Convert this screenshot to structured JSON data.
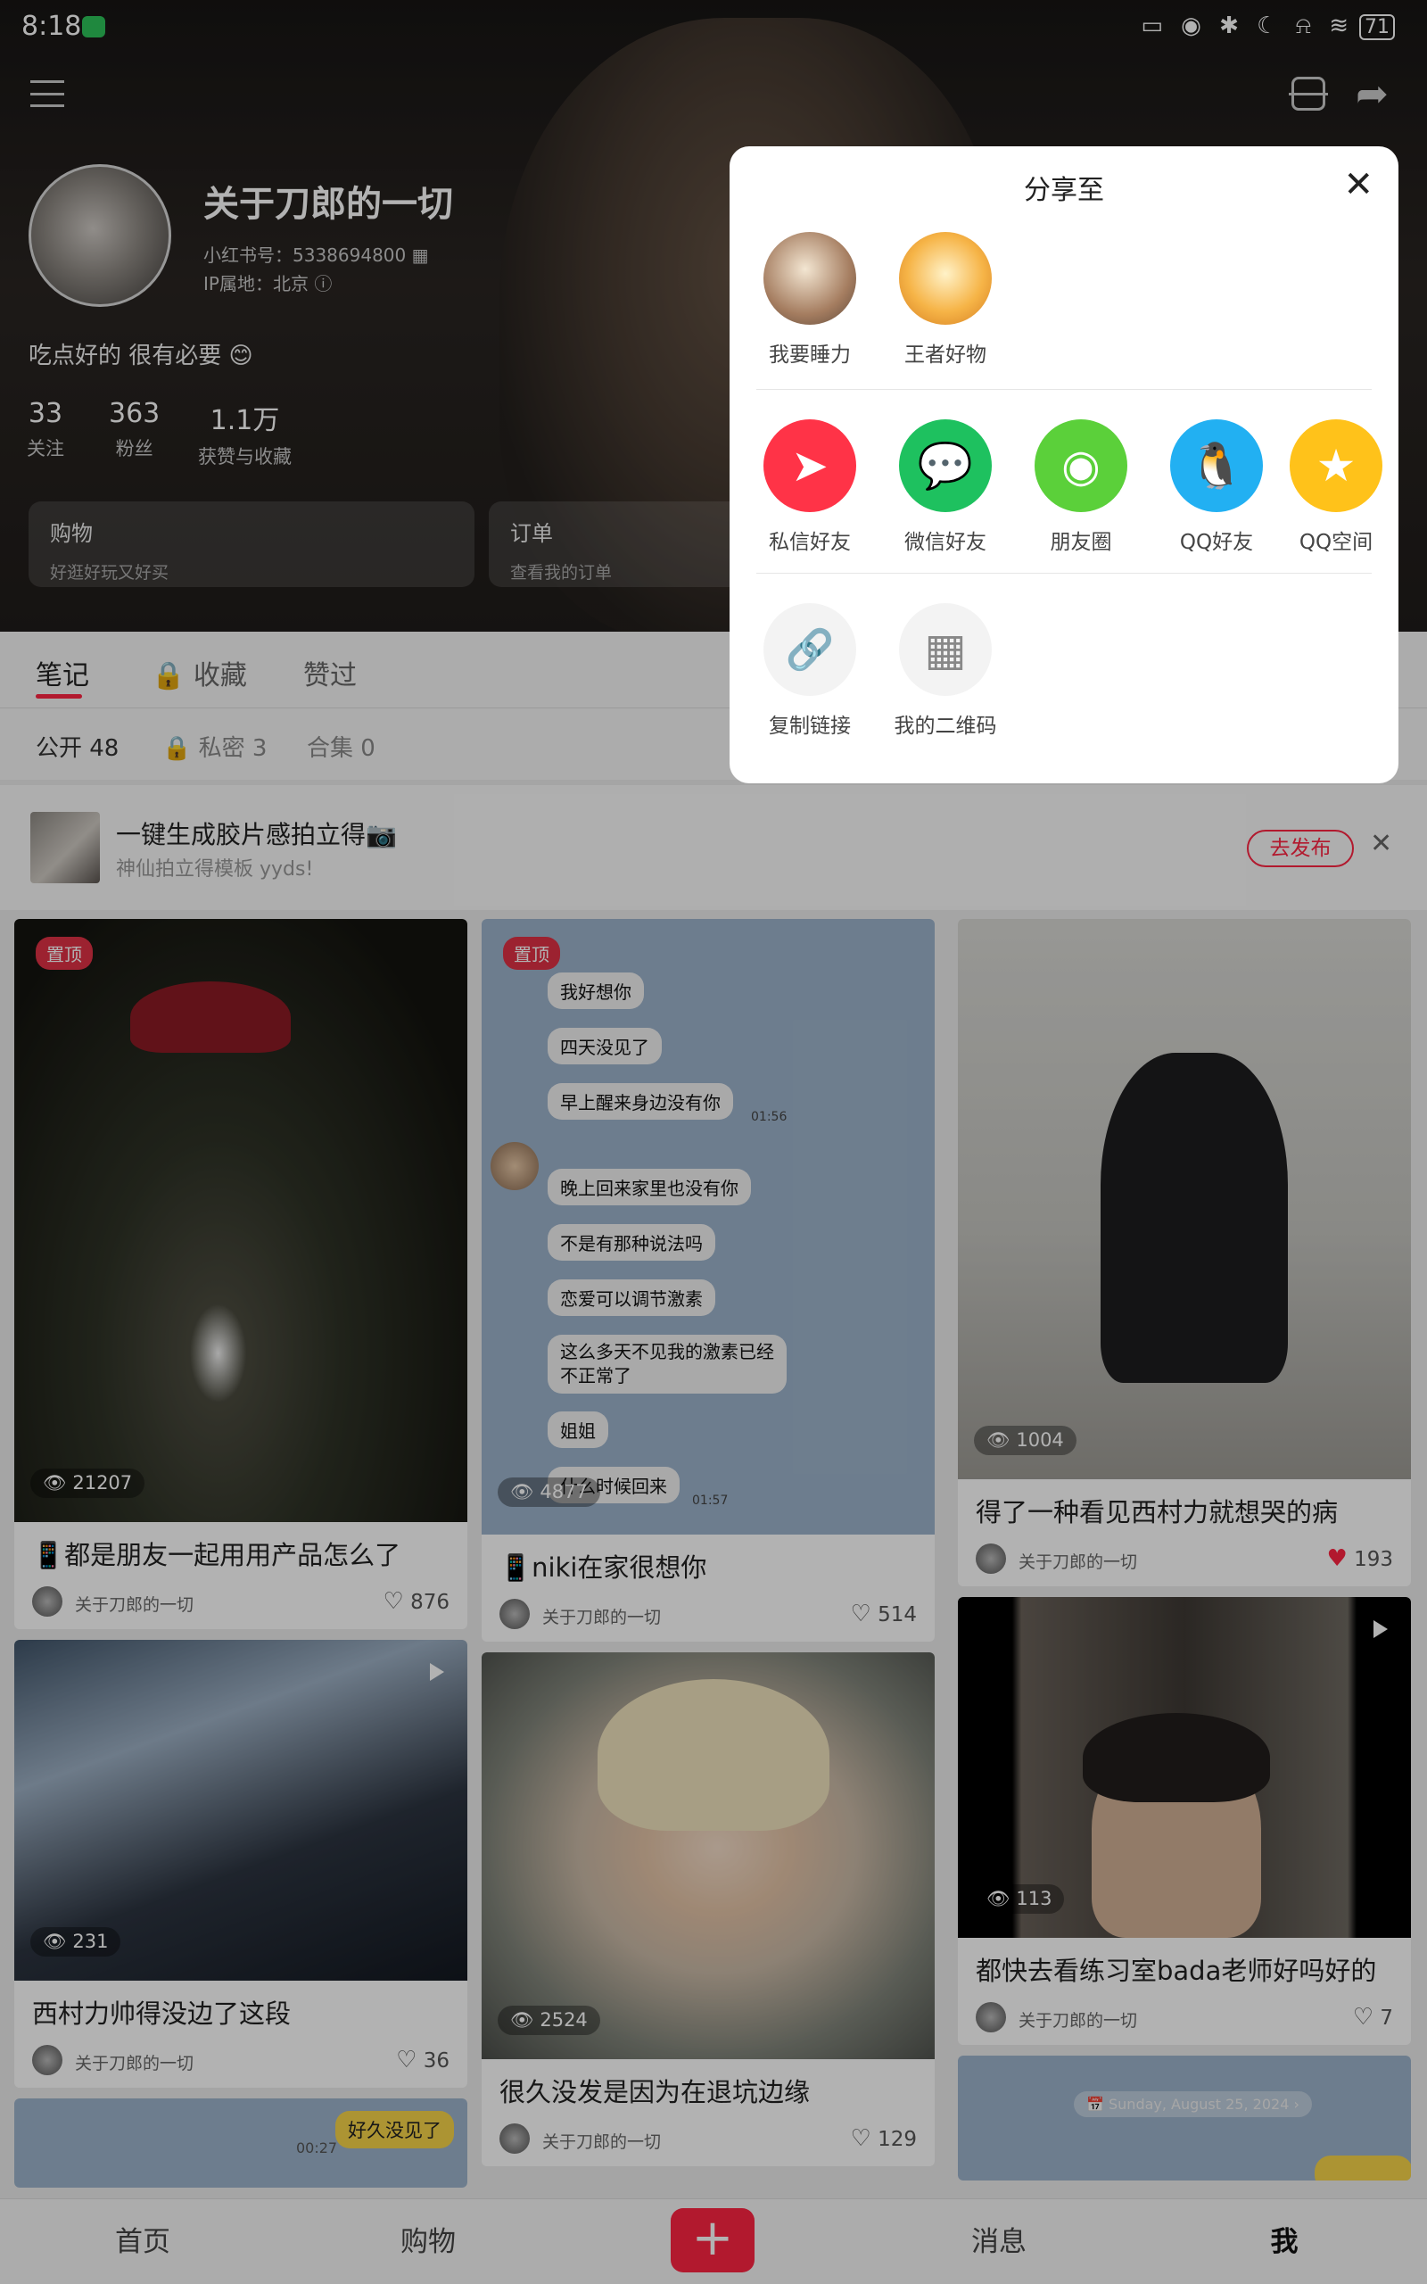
{
  "status_bar": {
    "time": "8:18",
    "battery": "71",
    "icons": "▭ ◉ ✱ ☾ ⍾ ≋"
  },
  "profile": {
    "name": "关于刀郎的一切",
    "red_id": "小红书号：5338694800 ▦",
    "ip": "IP属地：北京 ⓘ",
    "bio": "吃点好的 很有必要 😊",
    "stats": [
      {
        "num": "33",
        "label": "关注"
      },
      {
        "num": "363",
        "label": "粉丝"
      },
      {
        "num": "1.1万",
        "label": "获赞与收藏"
      }
    ],
    "cards": [
      {
        "title": "购物",
        "sub": "好逛好玩又好买"
      },
      {
        "title": "订单",
        "sub": "查看我的订单"
      }
    ]
  },
  "tabs": [
    "笔记",
    "🔒 收藏",
    "赞过"
  ],
  "subtabs": [
    "公开 48",
    "🔒 私密 3",
    "合集 0"
  ],
  "promo": {
    "title": "一键生成胶片感拍立得📷",
    "sub": "神仙拍立得模板 yyds!",
    "button": "去发布",
    "close": "✕"
  },
  "notes": {
    "col1": [
      {
        "pin": "置顶",
        "views": "21207",
        "title": "📱都是朋友一起用用产品怎么了",
        "author": "关于刀郎的一切",
        "likes": "876"
      },
      {
        "views": "231",
        "title": "西村力帅得没边了这段",
        "author": "关于刀郎的一切",
        "likes": "36"
      },
      {
        "time": "00:27",
        "tag": "好久没见了"
      }
    ],
    "col2": [
      {
        "pin": "置顶",
        "views": "4877",
        "title": "📱niki在家很想你",
        "author": "关于刀郎的一切",
        "likes": "514",
        "chat": [
          {
            "text": "我好想你"
          },
          {
            "text": "四天没见了"
          },
          {
            "text": "早上醒来身边没有你"
          },
          {
            "text": "01:56"
          },
          {
            "text": "晚上回来家里也没有你"
          },
          {
            "text": "不是有那种说法吗"
          },
          {
            "text": "恋爱可以调节激素"
          },
          {
            "text": "这么多天不见我的激素已经\n不正常了"
          },
          {
            "text": "姐姐"
          },
          {
            "text": "什么时候回来"
          },
          {
            "text": "01:57"
          }
        ]
      },
      {
        "views": "2524",
        "title": "很久没发是因为在退坑边缘",
        "author": "关于刀郎的一切",
        "likes": "129"
      }
    ],
    "col3": [
      {
        "views": "1004",
        "title": "得了一种看见西村力就想哭的病",
        "author": "关于刀郎的一切",
        "likes": "193"
      },
      {
        "views": "113",
        "title": "都快去看练习室bada老师好吗好的",
        "author": "关于刀郎的一切",
        "likes": "7"
      },
      {
        "date": "📅 Sunday, August 25, 2024 ›"
      }
    ]
  },
  "bottom_nav": [
    "首页",
    "购物",
    "+",
    "消息",
    "我"
  ],
  "share_sheet": {
    "title": "分享至",
    "close": "✕",
    "contacts": [
      {
        "label": "我要睡力"
      },
      {
        "label": "王者好物"
      }
    ],
    "apps": [
      {
        "label": "私信好友",
        "icon": "➤",
        "color": "#ff3347"
      },
      {
        "label": "微信好友",
        "icon": "💬",
        "color": "#1ec15f"
      },
      {
        "label": "朋友圈",
        "icon": "◉",
        "color": "#5bd03a"
      },
      {
        "label": "QQ好友",
        "icon": "🐧",
        "color": "#22b0f2"
      },
      {
        "label": "QQ空间",
        "icon": "★",
        "color": "#ffc21a"
      }
    ],
    "tools": [
      {
        "label": "复制链接",
        "icon": "🔗"
      },
      {
        "label": "我的二维码",
        "icon": "▦"
      }
    ]
  }
}
